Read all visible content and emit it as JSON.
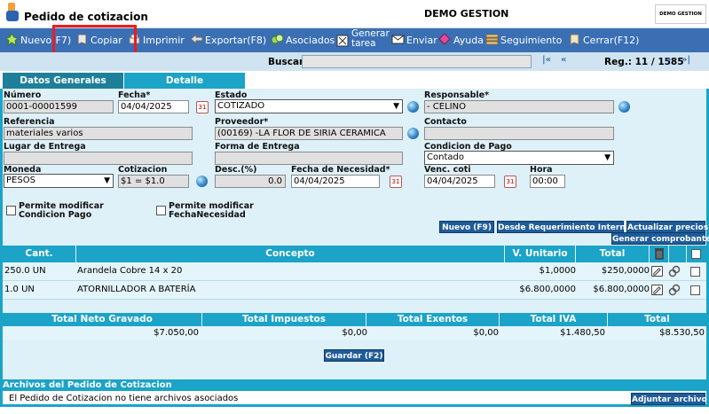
{
  "window": {
    "title": "Pedido de cotizacion",
    "company": "DEMO GESTION",
    "logo_text": "DEMO GESTION"
  },
  "toolbar": {
    "nuevo": "Nuevo(F7)",
    "copiar": "Copiar",
    "imprimir": "Imprimir",
    "exportar": "Exportar(F8)",
    "asociados": "Asociados",
    "generar_line1": "Generar",
    "generar_line2": "tarea",
    "enviar": "Enviar",
    "ayuda": "Ayuda",
    "seguimiento": "Seguimiento",
    "cerrar": "Cerrar(F12)"
  },
  "search": {
    "label": "Buscar",
    "value": "",
    "nav_first": "|«",
    "nav_prev": "«",
    "reg_label": "Reg.: 11 / 1585",
    "nav_next": "»",
    "nav_last": "»|"
  },
  "tabs": {
    "datos": "Datos Generales",
    "detalle": "Detalle"
  },
  "form": {
    "numero_label": "Número",
    "numero": "0001-00001599",
    "fecha_label": "Fecha*",
    "fecha": "04/04/2025",
    "estado_label": "Estado",
    "estado": "COTIZADO",
    "responsable_label": "Responsable*",
    "responsable": "- CELINO",
    "referencia_label": "Referencia",
    "referencia": "materiales varios",
    "proveedor_label": "Proveedor*",
    "proveedor": "(00169) -LA FLOR DE SIRIA CERAMICA",
    "contacto_label": "Contacto",
    "contacto": "",
    "lugar_label": "Lugar de Entrega",
    "lugar": "",
    "forma_label": "Forma de Entrega",
    "forma": "",
    "condicion_label": "Condicion de Pago",
    "condicion": "Contado",
    "moneda_label": "Moneda",
    "moneda": "PESOS",
    "cotizacion_label": "Cotizacion",
    "cotizacion": "$1 = $1.0",
    "desc_label": "Desc.(%)",
    "desc": "0.0",
    "necesidad_label": "Fecha de Necesidad*",
    "necesidad": "04/04/2025",
    "venc_label": "Venc. coti",
    "venc": "04/04/2025",
    "hora_label": "Hora",
    "hora": "00:00",
    "chk_condicion_l1": "Permite modificar",
    "chk_condicion_l2": "Condicion Pago",
    "chk_fecha_l1": "Permite modificar",
    "chk_fecha_l2": "FechaNecesidad"
  },
  "buttons": {
    "nuevo_f9": "Nuevo (F9)",
    "desde_req": "Desde Requerimiento Interno",
    "actualizar": "Actualizar precios",
    "generar_comp": "Generar comprobante",
    "guardar": "Guardar (F2)",
    "adjuntar": "Adjuntar archivo"
  },
  "detail": {
    "headers": {
      "cant": "Cant.",
      "concepto": "Concepto",
      "unitario": "V. Unitario",
      "total": "Total"
    },
    "rows": [
      {
        "cant": "250.0 UN",
        "concepto": "Arandela Cobre 14 x 20",
        "unitario": "$1,0000",
        "total": "$250,0000"
      },
      {
        "cant": "1.0 UN",
        "concepto": "ATORNILLADOR A BATERÍA",
        "unitario": "$6.800,0000",
        "total": "$6.800,0000"
      }
    ]
  },
  "totals": {
    "headers": {
      "neto": "Total Neto Gravado",
      "impuestos": "Total Impuestos",
      "exentos": "Total Exentos",
      "iva": "Total IVA",
      "total": "Total"
    },
    "values": {
      "neto": "$7.050,00",
      "impuestos": "$0,00",
      "exentos": "$0,00",
      "iva": "$1.480,50",
      "total": "$8.530,50"
    }
  },
  "archivos": {
    "title": "Archivos del Pedido de Cotizacion",
    "empty_msg": "El Pedido de Cotizacion no tiene archivos asociados"
  }
}
